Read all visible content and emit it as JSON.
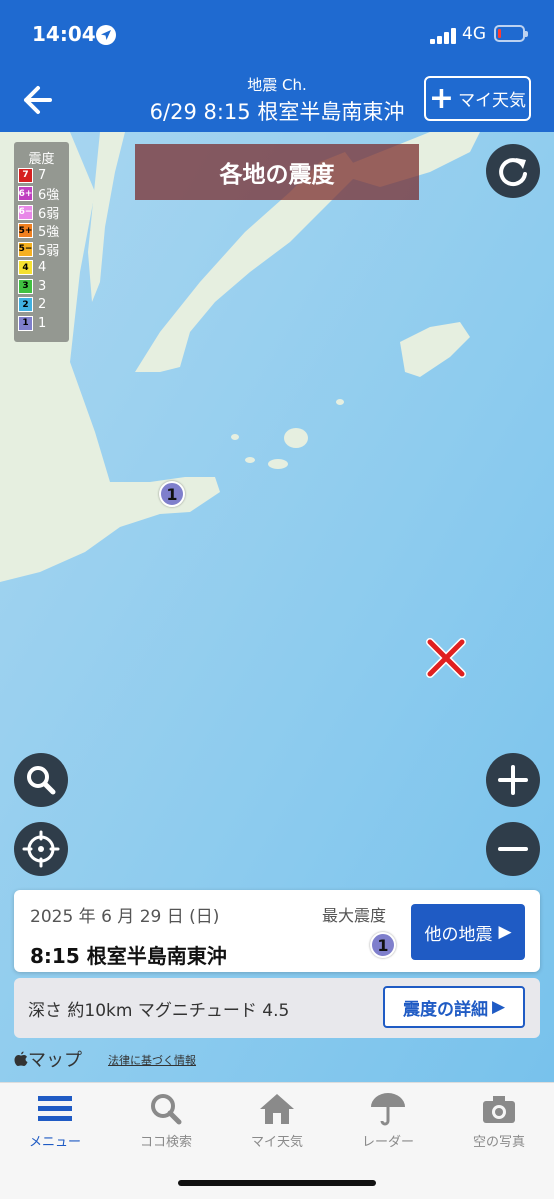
{
  "status": {
    "time": "14:04",
    "network": "4G"
  },
  "header": {
    "subtitle": "地震 Ch.",
    "title": "6/29 8:15 根室半島南東沖",
    "my_weather_label": "マイ天気",
    "my_weather_icon": "plus-icon"
  },
  "legend": {
    "title": "震度",
    "items": [
      {
        "badge": "7",
        "label": "7",
        "color": "#d62020"
      },
      {
        "badge": "6+",
        "label": "6強",
        "color": "#c040c0"
      },
      {
        "badge": "6−",
        "label": "6弱",
        "color": "#e888e8"
      },
      {
        "badge": "5+",
        "label": "5強",
        "color": "#f08020"
      },
      {
        "badge": "5−",
        "label": "5弱",
        "color": "#f5b020"
      },
      {
        "badge": "4",
        "label": "4",
        "color": "#f5e030"
      },
      {
        "badge": "3",
        "label": "3",
        "color": "#40c040"
      },
      {
        "badge": "2",
        "label": "2",
        "color": "#40b0e0"
      },
      {
        "badge": "1",
        "label": "1",
        "color": "#7f7fcc"
      }
    ]
  },
  "banner": {
    "text": "各地の震度"
  },
  "map": {
    "intensity_marker_value": "1",
    "intensity_marker_color": "#7f7fcc",
    "epicenter_color": "#e02020"
  },
  "card": {
    "date": "2025 年 6 月 29 日 (日)",
    "max_label": "最大震度",
    "max_value": "1",
    "place": "8:15 根室半島南東沖",
    "other_button": "他の地震",
    "other_button_arrow": "▶"
  },
  "card2": {
    "depth_text": "深さ 約10km マグニチュード 4.5",
    "detail_button": "震度の詳細",
    "detail_button_arrow": "▶"
  },
  "attribution": {
    "maps": "マップ",
    "legal": "法律に基づく情報"
  },
  "tabs": [
    {
      "label": "メニュー",
      "icon": "menu-icon",
      "active": true
    },
    {
      "label": "ココ検索",
      "icon": "search-icon",
      "active": false
    },
    {
      "label": "マイ天気",
      "icon": "home-icon",
      "active": false
    },
    {
      "label": "レーダー",
      "icon": "umbrella-icon",
      "active": false
    },
    {
      "label": "空の写真",
      "icon": "camera-icon",
      "active": false
    }
  ]
}
